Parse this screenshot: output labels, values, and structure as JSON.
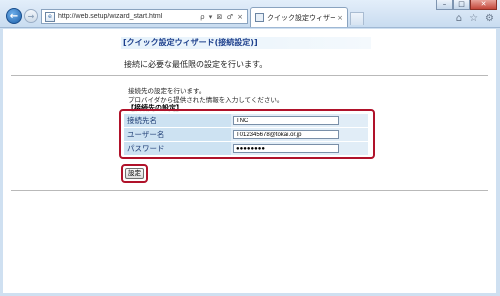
{
  "browser": {
    "url": "http://web.setup/wizard_start.html",
    "address_tools": "ρ ▾ ⊠ ♂ ×",
    "tab_title": "クイック設定ウィザード(...",
    "tab_close": "×"
  },
  "page": {
    "title": "[クイック設定ウィザード(接続設定)]",
    "subtitle": "接続に必要な最低限の設定を行います。",
    "intro_line1": "接続先の設定を行います。",
    "intro_line2": "プロバイダから提供された情報を入力してください。",
    "section_heading": "【接続先の設定】",
    "fields": [
      {
        "label": "接続先名",
        "value": "TNC"
      },
      {
        "label": "ユーザー名",
        "value": "T012345678@tokai.or.jp"
      },
      {
        "label": "パスワード",
        "value": "●●●●●●●●"
      }
    ],
    "submit_label": "設定"
  },
  "colors": {
    "highlight": "#b0122a",
    "label_bg": "#cde2f2",
    "title_text": "#1c3f8c"
  }
}
